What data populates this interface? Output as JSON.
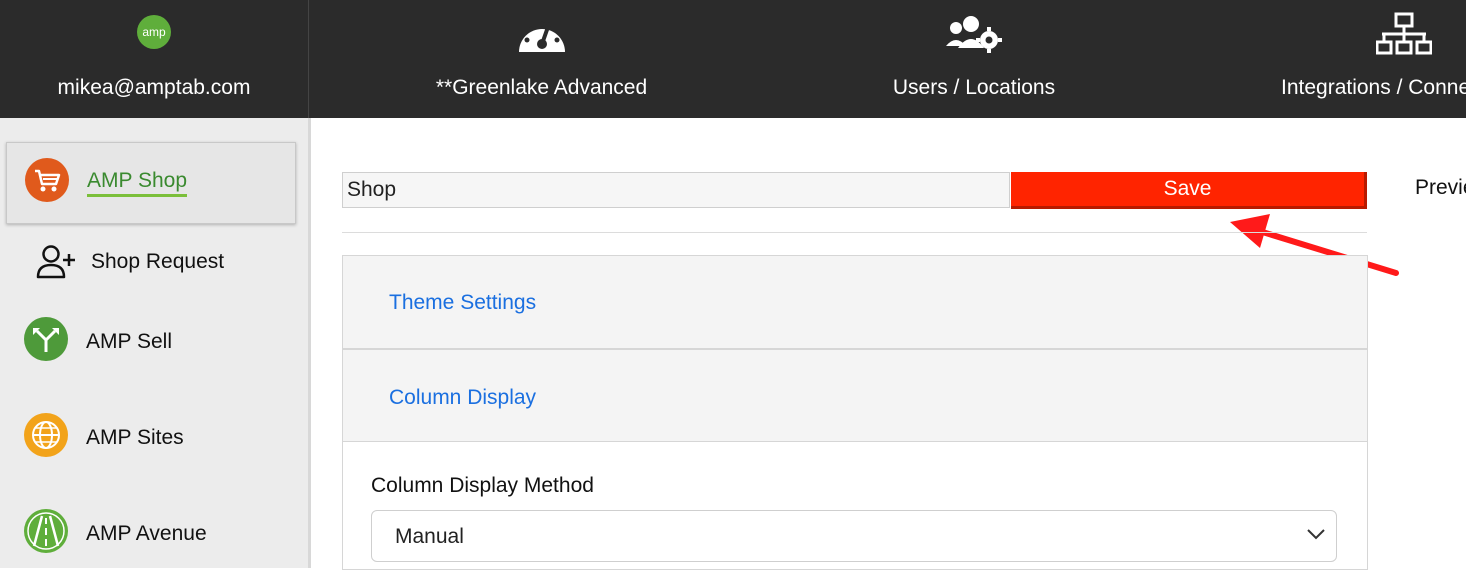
{
  "topbar": {
    "account_email": "mikea@amptab.com",
    "logo_text": "amp",
    "greenlake": "**Greenlake Advanced",
    "users": "Users / Locations",
    "integrations": "Integrations / Conne"
  },
  "sidebar": {
    "items": [
      {
        "label": "AMP Shop",
        "icon": "cart-icon",
        "color": "#e05a1c",
        "active": true
      },
      {
        "label": "Shop Request",
        "icon": "add-user-icon"
      },
      {
        "label": "AMP Sell",
        "icon": "arrows-icon",
        "color": "#4e9a3a"
      },
      {
        "label": "AMP Sites",
        "icon": "globe-icon",
        "color": "#f2a31a"
      },
      {
        "label": "AMP Avenue",
        "icon": "road-icon",
        "color": "#5fae3b"
      }
    ]
  },
  "main": {
    "shop_name_value": "Shop",
    "save_label": "Save",
    "preview_label": "Previe",
    "theme_settings": "Theme Settings",
    "column_display": "Column Display",
    "column_display_method_label": "Column Display Method",
    "column_display_method_value": "Manual"
  },
  "colors": {
    "topbar_bg": "#2b2b2b",
    "save_bg": "#ff2400",
    "link_blue": "#1a6fe0",
    "active_underline": "#7bbf3a",
    "annotation_arrow": "#ff1a1a"
  }
}
